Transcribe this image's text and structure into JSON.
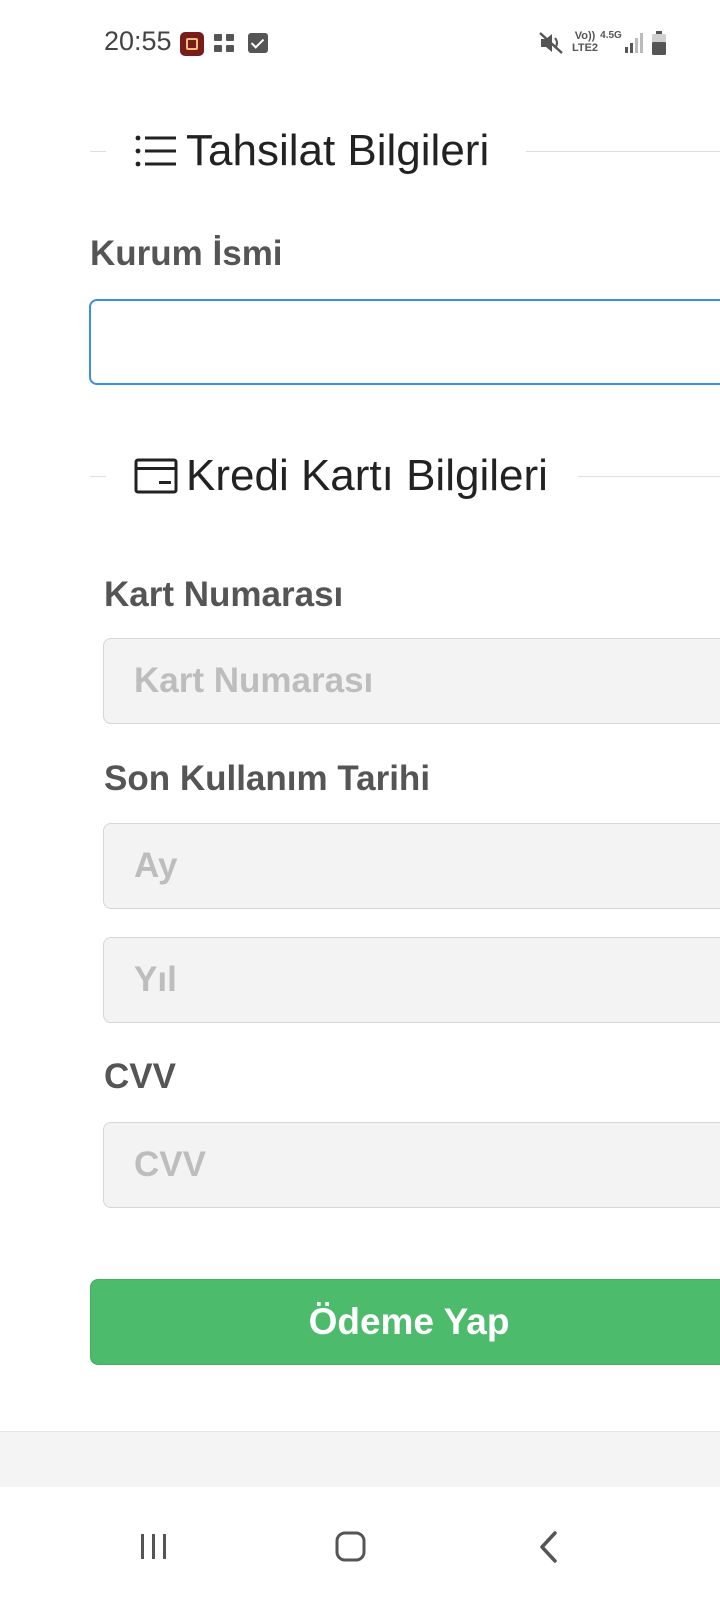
{
  "status_bar": {
    "time": "20:55",
    "volte": "Vo)) LTE2",
    "network": "4.5G",
    "icons": [
      "app-notification-icon",
      "grid-notification-icon",
      "checkbox-notification-icon",
      "mute-icon",
      "signal-icon",
      "battery-icon"
    ]
  },
  "billing_section": {
    "title": "Tahsilat Bilgileri",
    "icon": "list-icon",
    "institution_label": "Kurum İsmi",
    "institution_value": ""
  },
  "card_section": {
    "title": "Kredi Kartı Bilgileri",
    "icon": "credit-card-icon",
    "card_number_label": "Kart Numarası",
    "card_number_placeholder": "Kart Numarası",
    "expiry_label": "Son Kullanım Tarihi",
    "month_placeholder": "Ay",
    "year_placeholder": "Yıl",
    "cvv_label": "CVV",
    "cvv_placeholder": "CVV"
  },
  "actions": {
    "pay_label": "Ödeme Yap"
  },
  "colors": {
    "accent_blue": "#3a8fde",
    "pay_green": "#4cbb6b",
    "label_gray": "#555555",
    "placeholder_gray": "#bdbdbd"
  },
  "nav_bar": {
    "buttons": [
      "recent-apps-icon",
      "home-icon",
      "back-icon"
    ]
  }
}
